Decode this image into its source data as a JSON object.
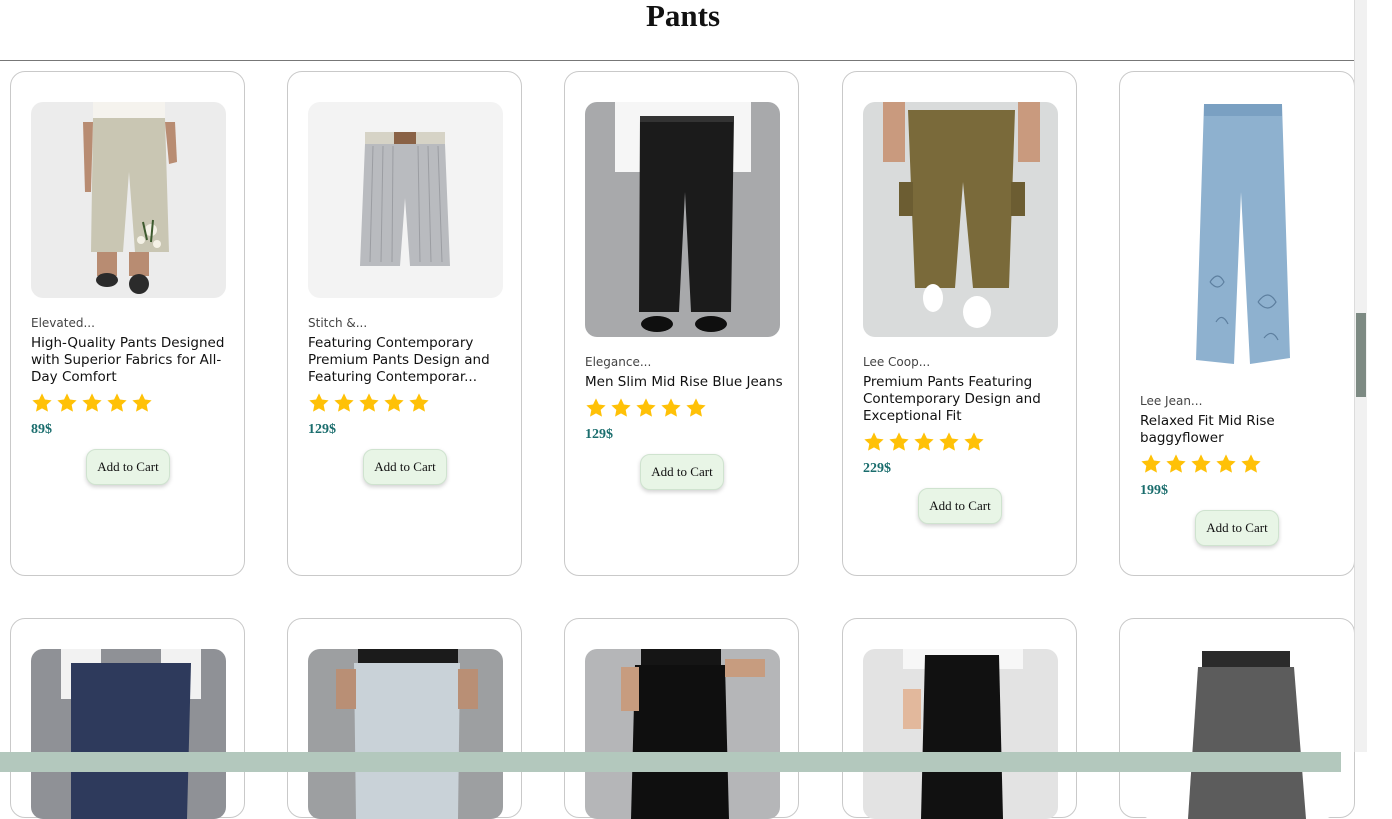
{
  "page": {
    "title": "Pants"
  },
  "products": [
    {
      "brand": "Elevated...",
      "name": "High-Quality Pants Designed with Superior Fabrics for All-Day Comfort",
      "rating": 5,
      "price": "89$",
      "cart_label": "Add to Cart"
    },
    {
      "brand": "Stitch &...",
      "name": "Featuring Contemporary Premium Pants Design and Featuring Contemporar...",
      "rating": 5,
      "price": "129$",
      "cart_label": "Add to Cart"
    },
    {
      "brand": "Elegance...",
      "name": "Men Slim Mid Rise Blue Jeans",
      "rating": 5,
      "price": "129$",
      "cart_label": "Add to Cart"
    },
    {
      "brand": "Lee Coop...",
      "name": "Premium Pants Featuring Contemporary Design and Exceptional Fit",
      "rating": 5,
      "price": "229$",
      "cart_label": "Add to Cart"
    },
    {
      "brand": "Lee Jean...",
      "name": "Relaxed Fit Mid Rise baggyflower",
      "rating": 5,
      "price": "199$",
      "cart_label": "Add to Cart"
    }
  ],
  "colors": {
    "star": "#ffc107",
    "price": "#1a6d6d",
    "cart_bg": "#e8f5e6",
    "bottom_bar": "#b3c8bd",
    "scroll_thumb": "#7d8a83"
  }
}
